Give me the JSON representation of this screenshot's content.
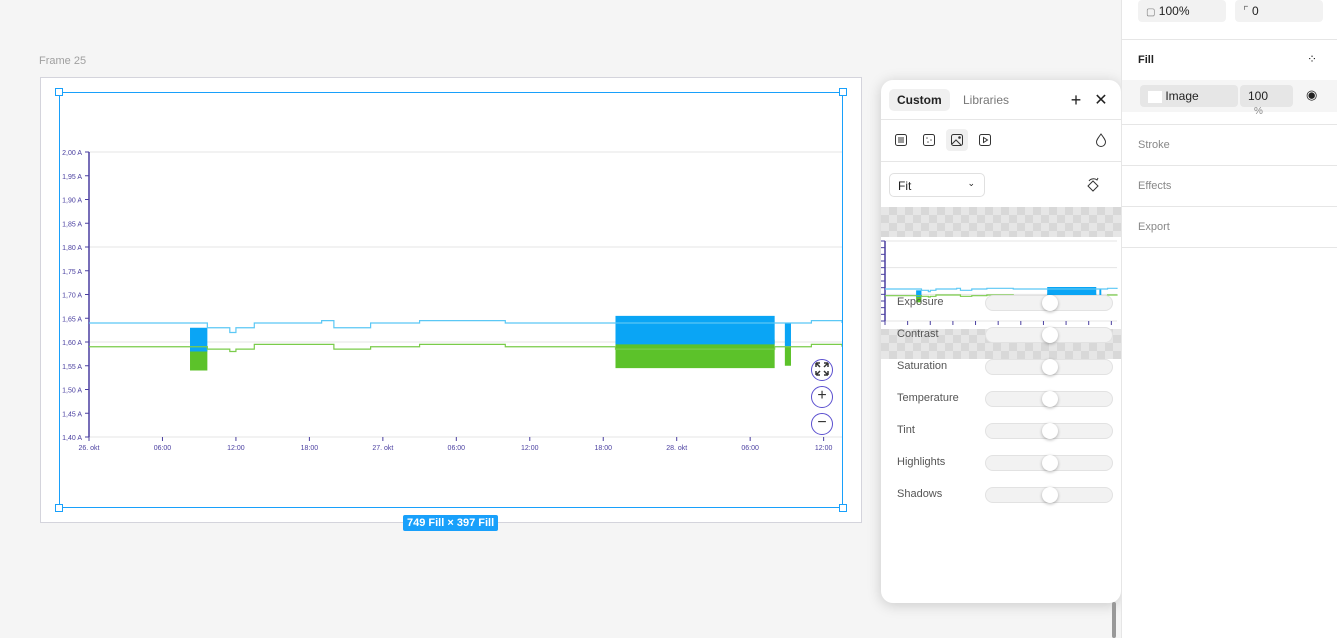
{
  "canvas": {
    "frame_label": "Frame 25",
    "size_badge": "749 Fill × 397 Fill"
  },
  "chart_data": {
    "type": "line",
    "y_ticks": [
      "2,00 A",
      "1,95 A",
      "1,90 A",
      "1,85 A",
      "1,80 A",
      "1,75 A",
      "1,70 A",
      "1,65 A",
      "1,60 A",
      "1,55 A",
      "1,50 A",
      "1,45 A",
      "1,40 A"
    ],
    "ylim": [
      1.4,
      2.0
    ],
    "x_ticks": [
      "26. okt",
      "06:00",
      "12:00",
      "18:00",
      "27. okt",
      "06:00",
      "12:00",
      "18:00",
      "28. okt",
      "06:00",
      "12:00"
    ],
    "xlim": [
      "2023-10-26T00:00",
      "2023-10-28T13:30"
    ],
    "grid": true,
    "colors": {
      "series1": "#5bc8f5",
      "series1_band": "#0aa5f5",
      "series2": "#7acc4a",
      "series2_band": "#5cc22a",
      "axis": "#4a3fa0"
    },
    "series": [
      {
        "points": [
          [
            "2023-10-26T00:00",
            1.64
          ],
          [
            "2023-10-26T08:15",
            1.64
          ],
          [
            "2023-10-26T09:40",
            1.63
          ],
          [
            "2023-10-26T11:30",
            1.62
          ],
          [
            "2023-10-26T12:00",
            1.63
          ],
          [
            "2023-10-26T13:30",
            1.64
          ],
          [
            "2023-10-26T19:00",
            1.645
          ],
          [
            "2023-10-26T20:00",
            1.63
          ],
          [
            "2023-10-26T23:00",
            1.64
          ],
          [
            "2023-10-27T03:00",
            1.645
          ],
          [
            "2023-10-27T08:00",
            1.645
          ],
          [
            "2023-10-27T10:00",
            1.64
          ],
          [
            "2023-10-27T19:00",
            1.64
          ],
          [
            "2023-10-28T08:00",
            1.64
          ],
          [
            "2023-10-28T09:30",
            1.64
          ],
          [
            "2023-10-28T11:00",
            1.645
          ],
          [
            "2023-10-28T13:30",
            1.64
          ]
        ],
        "bands": [
          [
            "2023-10-26T08:15",
            "2023-10-26T09:40",
            1.58,
            1.63
          ],
          [
            "2023-10-27T19:00",
            "2023-10-28T08:00",
            1.595,
            1.655
          ],
          [
            "2023-10-28T08:50",
            "2023-10-28T09:20",
            1.59,
            1.64
          ]
        ]
      },
      {
        "points": [
          [
            "2023-10-26T00:00",
            1.59
          ],
          [
            "2023-10-26T08:15",
            1.59
          ],
          [
            "2023-10-26T09:40",
            1.585
          ],
          [
            "2023-10-26T11:30",
            1.58
          ],
          [
            "2023-10-26T12:00",
            1.585
          ],
          [
            "2023-10-26T13:30",
            1.595
          ],
          [
            "2023-10-26T19:00",
            1.595
          ],
          [
            "2023-10-26T20:00",
            1.585
          ],
          [
            "2023-10-26T23:00",
            1.59
          ],
          [
            "2023-10-27T03:00",
            1.595
          ],
          [
            "2023-10-27T08:00",
            1.595
          ],
          [
            "2023-10-27T10:00",
            1.59
          ],
          [
            "2023-10-27T19:00",
            1.585
          ],
          [
            "2023-10-28T08:00",
            1.59
          ],
          [
            "2023-10-28T11:00",
            1.595
          ],
          [
            "2023-10-28T13:30",
            1.59
          ]
        ],
        "bands": [
          [
            "2023-10-26T08:15",
            "2023-10-26T09:40",
            1.54,
            1.59
          ],
          [
            "2023-10-27T19:00",
            "2023-10-28T08:00",
            1.545,
            1.605
          ],
          [
            "2023-10-28T08:50",
            "2023-10-28T09:20",
            1.55,
            1.59
          ]
        ]
      }
    ],
    "controls": {
      "fit": "expand-icon",
      "zoom_in": "+",
      "zoom_out": "−"
    }
  },
  "popup": {
    "tabs": [
      "Custom",
      "Libraries"
    ],
    "active_tab": "Custom",
    "fit_mode": "Fit",
    "adjustments": [
      {
        "label": "Exposure",
        "value": 0
      },
      {
        "label": "Contrast",
        "value": 0
      },
      {
        "label": "Saturation",
        "value": 0
      },
      {
        "label": "Temperature",
        "value": 0
      },
      {
        "label": "Tint",
        "value": 0
      },
      {
        "label": "Highlights",
        "value": 0
      },
      {
        "label": "Shadows",
        "value": 0
      }
    ]
  },
  "sidebar": {
    "opacity": "100%",
    "radius": "0",
    "fill_title": "Fill",
    "fill_type": "Image",
    "fill_opacity": "100",
    "fill_unit": "%",
    "sections": [
      "Stroke",
      "Effects",
      "Export"
    ]
  }
}
